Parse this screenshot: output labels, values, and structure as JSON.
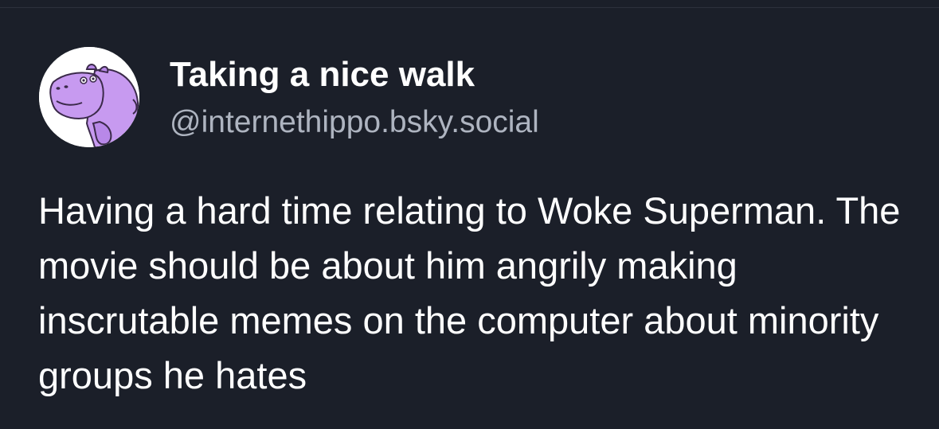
{
  "post": {
    "author": {
      "display_name": "Taking a nice walk",
      "handle": "@internethippo.bsky.social",
      "avatar_icon": "purple-hippo-avatar"
    },
    "text": "Having a hard time relating to Woke Superman. The movie should be about him angrily making inscrutable memes on the computer about minority groups he hates"
  },
  "colors": {
    "background": "#1b1f29",
    "text": "#ffffff",
    "handle": "#aeb4c0",
    "avatar_fill": "#c79af0"
  }
}
